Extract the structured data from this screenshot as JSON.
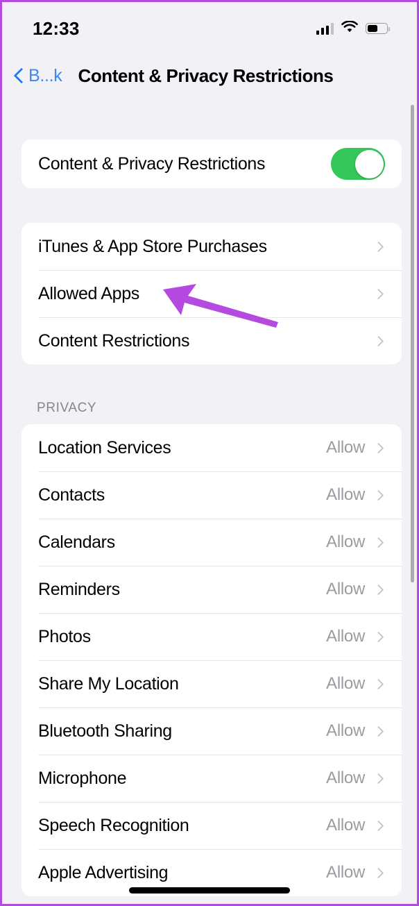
{
  "status_bar": {
    "time": "12:33",
    "signal_icon": "cellular-signal-icon",
    "wifi_icon": "wifi-icon",
    "battery_icon": "battery-icon",
    "battery_level_percent": 52
  },
  "nav": {
    "back_label": "B...k",
    "back_icon": "chevron-left-icon",
    "title": "Content & Privacy Restrictions"
  },
  "master_toggle": {
    "label": "Content & Privacy Restrictions",
    "state": "on",
    "accent_color": "#34c759"
  },
  "restrictions": {
    "items": [
      {
        "label": "iTunes & App Store Purchases"
      },
      {
        "label": "Allowed Apps"
      },
      {
        "label": "Content Restrictions"
      }
    ]
  },
  "privacy": {
    "header": "PRIVACY",
    "items": [
      {
        "label": "Location Services",
        "value": "Allow"
      },
      {
        "label": "Contacts",
        "value": "Allow"
      },
      {
        "label": "Calendars",
        "value": "Allow"
      },
      {
        "label": "Reminders",
        "value": "Allow"
      },
      {
        "label": "Photos",
        "value": "Allow"
      },
      {
        "label": "Share My Location",
        "value": "Allow"
      },
      {
        "label": "Bluetooth Sharing",
        "value": "Allow"
      },
      {
        "label": "Microphone",
        "value": "Allow"
      },
      {
        "label": "Speech Recognition",
        "value": "Allow"
      },
      {
        "label": "Apple Advertising",
        "value": "Allow"
      }
    ]
  },
  "annotation": {
    "arrow_color": "#b44ae0",
    "points_at": "Allowed Apps"
  },
  "frame": {
    "border_color": "#b44ae0",
    "background_color": "#f2f1f6"
  }
}
